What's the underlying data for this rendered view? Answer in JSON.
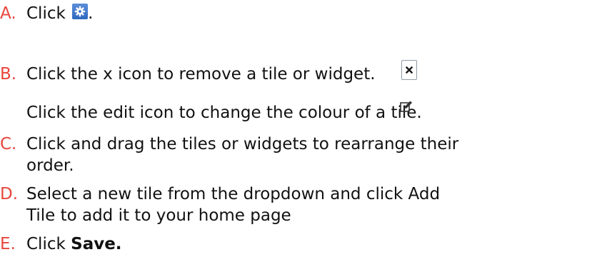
{
  "steps": {
    "a": {
      "marker": "A.",
      "text_before": "Click ",
      "text_after": ".",
      "icon": "settings-gear-icon"
    },
    "b": {
      "marker": "B.",
      "text": "Click the x icon to remove a tile or widget.",
      "icon": "close-x-icon",
      "line2": "Click the edit icon to change the colour of a tile.",
      "icon2": "edit-pencil-icon"
    },
    "c": {
      "marker": "C.",
      "line1": "Click and drag the tiles or widgets to rearrange their",
      "line2": "order."
    },
    "d": {
      "marker": "D.",
      "line1": "Select a new tile from the dropdown and click Add",
      "line2": "Tile to add it to your home page"
    },
    "e": {
      "marker": "E.",
      "text_before": "Click ",
      "bold": "Save."
    }
  },
  "colors": {
    "marker": "#e8453c",
    "gear_button": "#3a76cc",
    "text": "#111111"
  }
}
